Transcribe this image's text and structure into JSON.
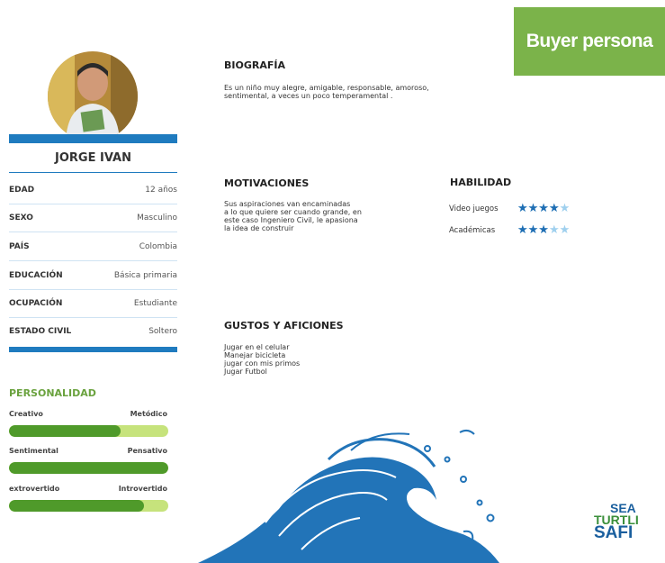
{
  "header": {
    "badge": "Buyer persona"
  },
  "profile": {
    "name": "JORGE IVAN",
    "fields": [
      {
        "label": "EDAD",
        "value": "12 años"
      },
      {
        "label": "SEXO",
        "value": "Masculino"
      },
      {
        "label": "PAÍS",
        "value": "Colombia"
      },
      {
        "label": "EDUCACIÓN",
        "value": "Básica primaria"
      },
      {
        "label": "OCUPACIÓN",
        "value": "Estudiante"
      },
      {
        "label": "ESTADO CIVIL",
        "value": "Soltero"
      }
    ]
  },
  "personality": {
    "title": "PERSONALIDAD",
    "traits": [
      {
        "left": "Creativo",
        "right": "Metódico",
        "level": 0.7
      },
      {
        "left": "Sentimental",
        "right": "Pensativo",
        "level": 1.0
      },
      {
        "left": "extrovertido",
        "right": "Introvertido",
        "level": 0.85
      }
    ]
  },
  "biography": {
    "title": "BIOGRAFÍA",
    "lines": [
      "Es un niño muy alegre, amigable, responsable, amoroso,",
      "sentimental, a veces un poco temperamental ."
    ]
  },
  "motivations": {
    "title": "MOTIVACIONES",
    "lines": [
      "Sus aspiraciones van encaminadas",
      "a lo que quiere ser cuando grande, en",
      "este caso Ingeniero Civil, le apasiona",
      "la idea de construir"
    ]
  },
  "skills": {
    "title": "HABILIDAD",
    "items": [
      {
        "label": "Video juegos",
        "stars": 4,
        "max": 5
      },
      {
        "label": "Académicas",
        "stars": 3,
        "max": 5
      }
    ]
  },
  "hobbies": {
    "title": "GUSTOS Y AFICIONES",
    "lines": [
      "Jugar en el celular",
      "Manejar bicicleta",
      "jugar con mis primos",
      "Jugar Futbol"
    ]
  },
  "logo": {
    "lines": [
      "SEA",
      "TURTLI",
      "SAFI"
    ]
  },
  "colors": {
    "accent_green": "#7bb34a",
    "accent_blue": "#1f7bbf",
    "bar_dark": "#4f9a2a",
    "bar_light": "#c6e37c"
  }
}
